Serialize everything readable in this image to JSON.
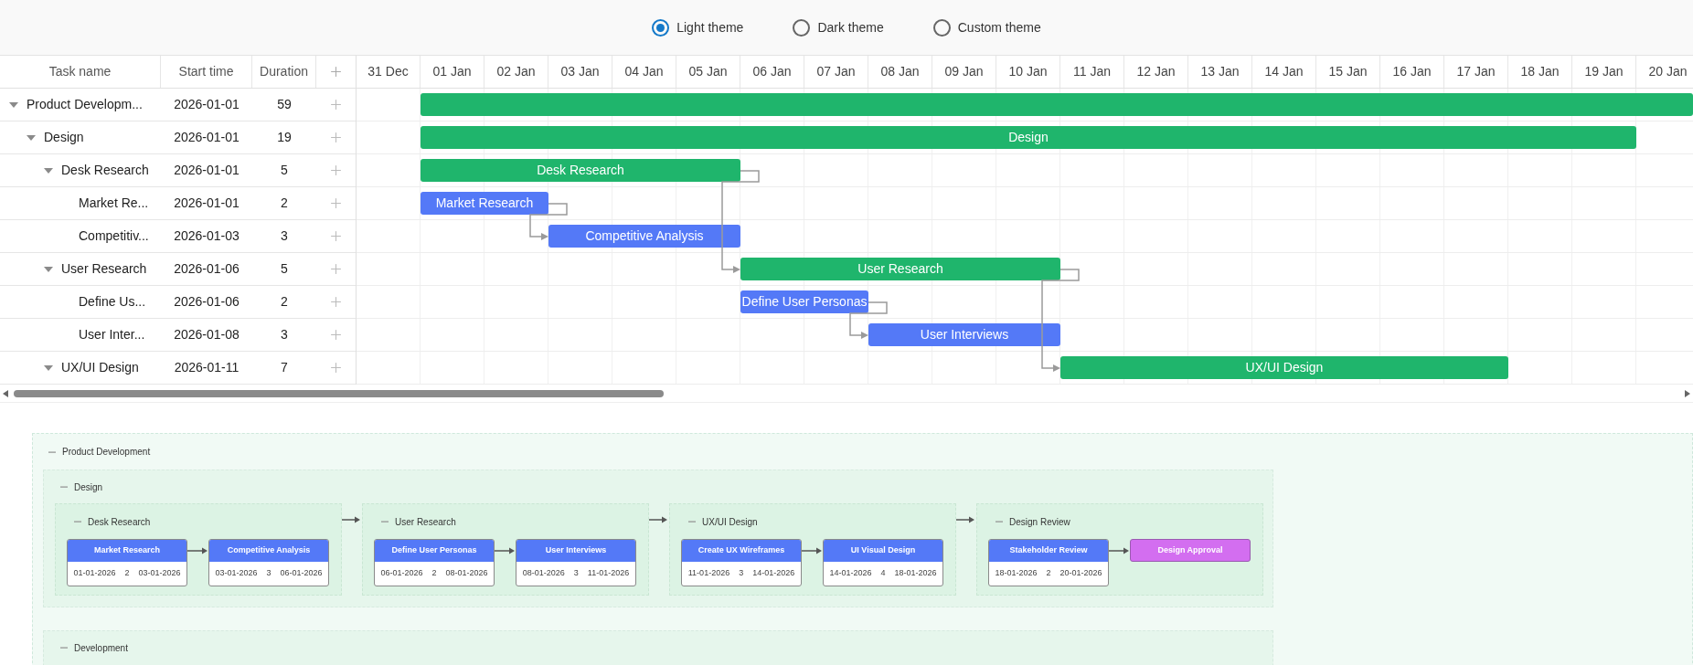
{
  "theme_options": [
    {
      "label": "Light theme",
      "selected": true
    },
    {
      "label": "Dark theme",
      "selected": false
    },
    {
      "label": "Custom theme",
      "selected": false
    }
  ],
  "grid": {
    "columns": [
      "Task name",
      "Start time",
      "Duration"
    ]
  },
  "timeline": {
    "days": [
      "31 Dec",
      "01 Jan",
      "02 Jan",
      "03 Jan",
      "04 Jan",
      "05 Jan",
      "06 Jan",
      "07 Jan",
      "08 Jan",
      "09 Jan",
      "10 Jan",
      "11 Jan",
      "12 Jan",
      "13 Jan",
      "14 Jan",
      "15 Jan",
      "16 Jan",
      "17 Jan",
      "18 Jan",
      "19 Jan",
      "20 Jan"
    ]
  },
  "tasks": [
    {
      "name": "Product Developm...",
      "start": "2026-01-01",
      "duration": "59",
      "kind": "summary",
      "expanded": true,
      "children": [
        {
          "name": "Design",
          "start": "2026-01-01",
          "duration": "19",
          "kind": "summary",
          "bar_label": "Design",
          "expanded": true,
          "children": [
            {
              "name": "Desk Research",
              "start": "2026-01-01",
              "duration": "5",
              "kind": "summary",
              "bar_label": "Desk Research",
              "expanded": true,
              "children": [
                {
                  "name": "Market Re...",
                  "start": "2026-01-01",
                  "duration": "2",
                  "kind": "task",
                  "bar_label": "Market Research"
                },
                {
                  "name": "Competitiv...",
                  "start": "2026-01-03",
                  "duration": "3",
                  "kind": "task",
                  "bar_label": "Competitive Analysis"
                }
              ]
            },
            {
              "name": "User Research",
              "start": "2026-01-06",
              "duration": "5",
              "kind": "summary",
              "bar_label": "User Research",
              "expanded": true,
              "children": [
                {
                  "name": "Define Us...",
                  "start": "2026-01-06",
                  "duration": "2",
                  "kind": "task",
                  "bar_label": "Define User Personas"
                },
                {
                  "name": "User Inter...",
                  "start": "2026-01-08",
                  "duration": "3",
                  "kind": "task",
                  "bar_label": "User Interviews"
                }
              ]
            },
            {
              "name": "UX/UI Design",
              "start": "2026-01-11",
              "duration": "7",
              "kind": "summary",
              "bar_label": "UX/UI Design",
              "expanded": true
            }
          ]
        }
      ]
    }
  ],
  "board": {
    "title": "Product Development",
    "expanded": true,
    "sections": [
      {
        "title": "Design",
        "expanded": true,
        "groups": [
          {
            "title": "Desk Research",
            "expanded": true,
            "cards": [
              {
                "kind": "task",
                "title": "Market Research",
                "start": "01-01-2026",
                "duration": "2",
                "end": "03-01-2026"
              },
              {
                "kind": "task",
                "title": "Competitive Analysis",
                "start": "03-01-2026",
                "duration": "3",
                "end": "06-01-2026"
              }
            ]
          },
          {
            "title": "User Research",
            "expanded": true,
            "cards": [
              {
                "kind": "task",
                "title": "Define User Personas",
                "start": "06-01-2026",
                "duration": "2",
                "end": "08-01-2026"
              },
              {
                "kind": "task",
                "title": "User Interviews",
                "start": "08-01-2026",
                "duration": "3",
                "end": "11-01-2026"
              }
            ]
          },
          {
            "title": "UX/UI Design",
            "expanded": true,
            "cards": [
              {
                "kind": "task",
                "title": "Create UX Wireframes",
                "start": "11-01-2026",
                "duration": "3",
                "end": "14-01-2026"
              },
              {
                "kind": "task",
                "title": "UI Visual Design",
                "start": "14-01-2026",
                "duration": "4",
                "end": "18-01-2026"
              }
            ]
          },
          {
            "title": "Design Review",
            "expanded": true,
            "cards": [
              {
                "kind": "task",
                "title": "Stakeholder Review",
                "start": "18-01-2026",
                "duration": "2",
                "end": "20-01-2026"
              },
              {
                "kind": "milestone",
                "title": "Design Approval"
              }
            ]
          }
        ]
      },
      {
        "title": "Development",
        "expanded": true
      }
    ]
  }
}
